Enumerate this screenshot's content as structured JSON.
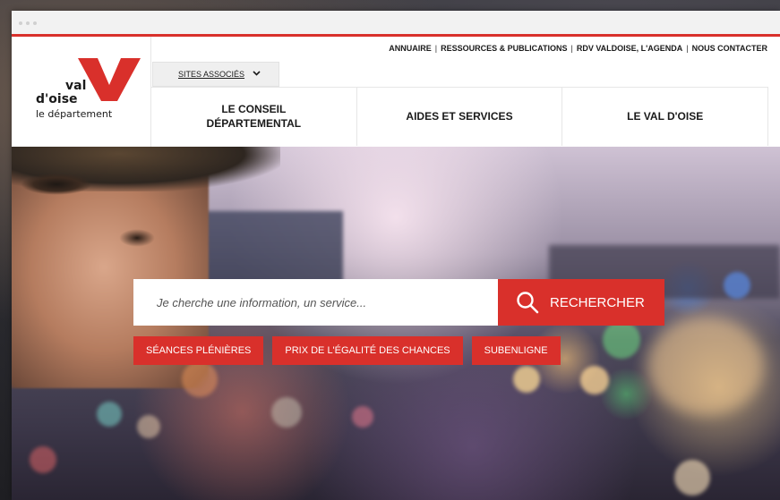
{
  "logo": {
    "line1": "val",
    "line2": "d'oise",
    "line3": "le département",
    "icon": "val-doise-v-logo-icon",
    "color": "#d9302b"
  },
  "header": {
    "top_links": [
      "ANNUAIRE",
      "RESSOURCES & PUBLICATIONS",
      "RDV VALDOISE, L'AGENDA",
      "NOUS CONTACTER"
    ],
    "sites_associes": "SITES ASSOCIÉS",
    "sites_icon": "chevron-down-icon"
  },
  "nav": {
    "items": [
      {
        "line1": "LE CONSEIL",
        "line2": "DÉPARTEMENTAL"
      },
      {
        "line1": "AIDES ET SERVICES",
        "line2": ""
      },
      {
        "line1": "LE VAL D'OISE",
        "line2": ""
      }
    ]
  },
  "search": {
    "placeholder": "Je cherche une information, un service...",
    "button_label": "RECHERCHER",
    "button_icon": "search-icon"
  },
  "quick_links": [
    "SÉANCES PLÉNIÈRES",
    "PRIX DE L'ÉGALITÉ DES CHANCES",
    "SUBENLIGNE"
  ],
  "colors": {
    "accent": "#d9302b",
    "text": "#1a1a1a"
  }
}
